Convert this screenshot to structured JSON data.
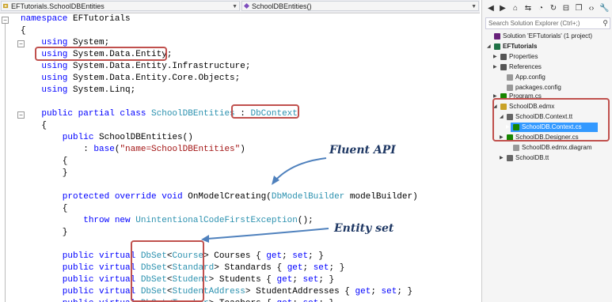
{
  "navbar": {
    "project_dropdown": "EFTutorials.SchoolDBEntities",
    "member_dropdown": "SchoolDBEntities()"
  },
  "code_lines": [
    {
      "parts": [
        {
          "t": "namespace ",
          "c": "kw"
        },
        {
          "t": "EFTutorials",
          "c": ""
        }
      ]
    },
    {
      "parts": [
        {
          "t": "{",
          "c": ""
        }
      ]
    },
    {
      "parts": [
        {
          "t": "    using ",
          "c": "kw"
        },
        {
          "t": "System;",
          "c": ""
        }
      ]
    },
    {
      "parts": [
        {
          "t": "    using ",
          "c": "kw"
        },
        {
          "t": "System.Data.Entity;",
          "c": ""
        }
      ]
    },
    {
      "parts": [
        {
          "t": "    using ",
          "c": "kw"
        },
        {
          "t": "System.Data.Entity.Infrastructure;",
          "c": ""
        }
      ]
    },
    {
      "parts": [
        {
          "t": "    using ",
          "c": "kw"
        },
        {
          "t": "System.Data.Entity.Core.Objects;",
          "c": ""
        }
      ]
    },
    {
      "parts": [
        {
          "t": "    using ",
          "c": "kw"
        },
        {
          "t": "System.Linq;",
          "c": ""
        }
      ]
    },
    {
      "parts": []
    },
    {
      "parts": [
        {
          "t": "    public partial class ",
          "c": "kw"
        },
        {
          "t": "SchoolDBEntities",
          "c": "ty"
        },
        {
          "t": " : ",
          "c": ""
        },
        {
          "t": "DbContext",
          "c": "ty"
        }
      ]
    },
    {
      "parts": [
        {
          "t": "    {",
          "c": ""
        }
      ]
    },
    {
      "parts": [
        {
          "t": "        public ",
          "c": "kw"
        },
        {
          "t": "SchoolDBEntities()",
          "c": ""
        }
      ]
    },
    {
      "parts": [
        {
          "t": "            : ",
          "c": ""
        },
        {
          "t": "base",
          "c": "kw"
        },
        {
          "t": "(",
          "c": ""
        },
        {
          "t": "\"name=SchoolDBEntities\"",
          "c": "st"
        },
        {
          "t": ")",
          "c": ""
        }
      ]
    },
    {
      "parts": [
        {
          "t": "        {",
          "c": ""
        }
      ]
    },
    {
      "parts": [
        {
          "t": "        }",
          "c": ""
        }
      ]
    },
    {
      "parts": []
    },
    {
      "parts": [
        {
          "t": "        protected override void ",
          "c": "kw"
        },
        {
          "t": "OnModelCreating(",
          "c": ""
        },
        {
          "t": "DbModelBuilder",
          "c": "ty"
        },
        {
          "t": " modelBuilder)",
          "c": ""
        }
      ]
    },
    {
      "parts": [
        {
          "t": "        {",
          "c": ""
        }
      ]
    },
    {
      "parts": [
        {
          "t": "            throw new ",
          "c": "kw"
        },
        {
          "t": "UnintentionalCodeFirstException",
          "c": "ty"
        },
        {
          "t": "();",
          "c": ""
        }
      ]
    },
    {
      "parts": [
        {
          "t": "        }",
          "c": ""
        }
      ]
    },
    {
      "parts": []
    },
    {
      "parts": [
        {
          "t": "        public virtual ",
          "c": "kw"
        },
        {
          "t": "DbSet",
          "c": "ty"
        },
        {
          "t": "<",
          "c": ""
        },
        {
          "t": "Course",
          "c": "ty"
        },
        {
          "t": "> Courses { ",
          "c": ""
        },
        {
          "t": "get",
          "c": "kw"
        },
        {
          "t": "; ",
          "c": ""
        },
        {
          "t": "set",
          "c": "kw"
        },
        {
          "t": "; }",
          "c": ""
        }
      ]
    },
    {
      "parts": [
        {
          "t": "        public virtual ",
          "c": "kw"
        },
        {
          "t": "DbSet",
          "c": "ty"
        },
        {
          "t": "<",
          "c": ""
        },
        {
          "t": "Standard",
          "c": "ty"
        },
        {
          "t": "> Standards { ",
          "c": ""
        },
        {
          "t": "get",
          "c": "kw"
        },
        {
          "t": "; ",
          "c": ""
        },
        {
          "t": "set",
          "c": "kw"
        },
        {
          "t": "; }",
          "c": ""
        }
      ]
    },
    {
      "parts": [
        {
          "t": "        public virtual ",
          "c": "kw"
        },
        {
          "t": "DbSet",
          "c": "ty"
        },
        {
          "t": "<",
          "c": ""
        },
        {
          "t": "Student",
          "c": "ty"
        },
        {
          "t": "> Students { ",
          "c": ""
        },
        {
          "t": "get",
          "c": "kw"
        },
        {
          "t": "; ",
          "c": ""
        },
        {
          "t": "set",
          "c": "kw"
        },
        {
          "t": "; }",
          "c": ""
        }
      ]
    },
    {
      "parts": [
        {
          "t": "        public virtual ",
          "c": "kw"
        },
        {
          "t": "DbSet",
          "c": "ty"
        },
        {
          "t": "<",
          "c": ""
        },
        {
          "t": "StudentAddress",
          "c": "ty"
        },
        {
          "t": "> StudentAddresses { ",
          "c": ""
        },
        {
          "t": "get",
          "c": "kw"
        },
        {
          "t": "; ",
          "c": ""
        },
        {
          "t": "set",
          "c": "kw"
        },
        {
          "t": "; }",
          "c": ""
        }
      ]
    },
    {
      "parts": [
        {
          "t": "        public virtual ",
          "c": "kw"
        },
        {
          "t": "DbSet",
          "c": "ty"
        },
        {
          "t": "<",
          "c": ""
        },
        {
          "t": "Teacher",
          "c": "ty"
        },
        {
          "t": "> Teachers { ",
          "c": ""
        },
        {
          "t": "get",
          "c": "kw"
        },
        {
          "t": "; ",
          "c": ""
        },
        {
          "t": "set",
          "c": "kw"
        },
        {
          "t": "; }",
          "c": ""
        }
      ]
    }
  ],
  "annotations": {
    "fluent_api": "Fluent API",
    "entity_set": "Entity set"
  },
  "solution_explorer": {
    "search_placeholder": "Search Solution Explorer (Ctrl+;)",
    "items": [
      {
        "label": "Solution 'EFTutorials' (1 project)",
        "bold": false
      },
      {
        "label": "EFTutorials",
        "bold": true
      },
      {
        "label": "Properties",
        "bold": false
      },
      {
        "label": "References",
        "bold": false
      },
      {
        "label": "App.config",
        "bold": false
      },
      {
        "label": "packages.config",
        "bold": false
      },
      {
        "label": "Program.cs",
        "bold": false
      },
      {
        "label": "SchoolDB.edmx",
        "bold": false
      },
      {
        "label": "SchoolDB.Context.tt",
        "bold": false
      },
      {
        "label": "SchoolDB.Context.cs",
        "bold": false
      },
      {
        "label": "SchoolDB.Designer.cs",
        "bold": false
      },
      {
        "label": "SchoolDB.edmx.diagram",
        "bold": false
      },
      {
        "label": "SchoolDB.tt",
        "bold": false
      }
    ]
  },
  "colors": {
    "keyword": "#0000ff",
    "type": "#2b91af",
    "string": "#a31515",
    "highlight_box": "#c0504d",
    "annotation_arrow": "#4f81bd",
    "selection": "#3399ff"
  }
}
